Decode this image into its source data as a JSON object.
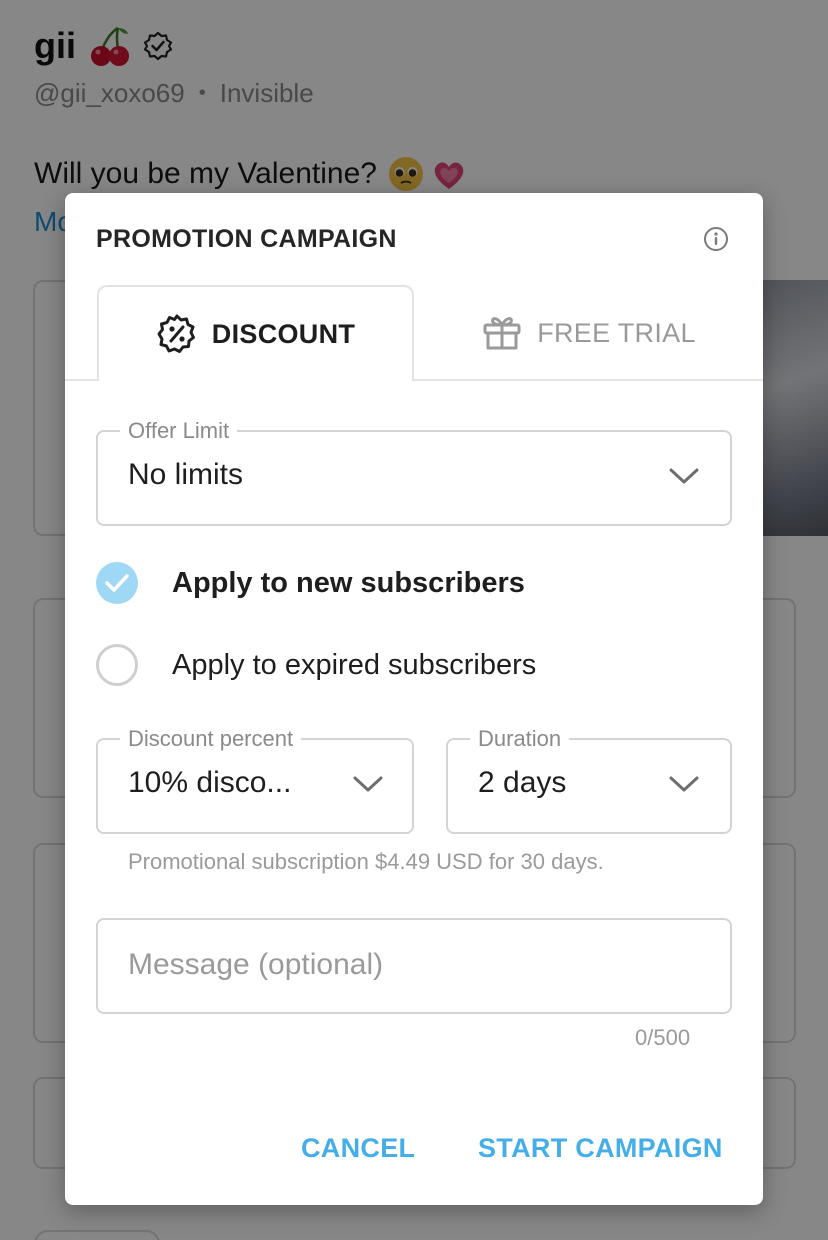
{
  "profile": {
    "name": "gii",
    "handle": "@gii_xoxo69",
    "status": "Invisible",
    "post_text": "Will you be my Valentine?",
    "more_link": "Mo"
  },
  "dialog": {
    "title": "PROMOTION CAMPAIGN",
    "tabs": [
      {
        "label": "DISCOUNT",
        "icon": "discount-badge-icon",
        "active": true
      },
      {
        "label": "FREE TRIAL",
        "icon": "gift-icon",
        "active": false
      }
    ],
    "offer_limit": {
      "label": "Offer Limit",
      "value": "No limits"
    },
    "options": [
      {
        "label": "Apply to new subscribers",
        "checked": true
      },
      {
        "label": "Apply to expired subscribers",
        "checked": false
      }
    ],
    "discount": {
      "label": "Discount percent",
      "value": "10% disco..."
    },
    "duration": {
      "label": "Duration",
      "value": "2 days"
    },
    "helper_text": "Promotional subscription $4.49 USD for 30 days.",
    "message": {
      "placeholder": "Message (optional)",
      "counter": "0/500"
    },
    "buttons": {
      "cancel": "CANCEL",
      "start": "START CAMPAIGN"
    }
  },
  "colors": {
    "accent": "#45aee8",
    "checked_radio": "#9fd8f4",
    "link": "#1f8fd6"
  }
}
